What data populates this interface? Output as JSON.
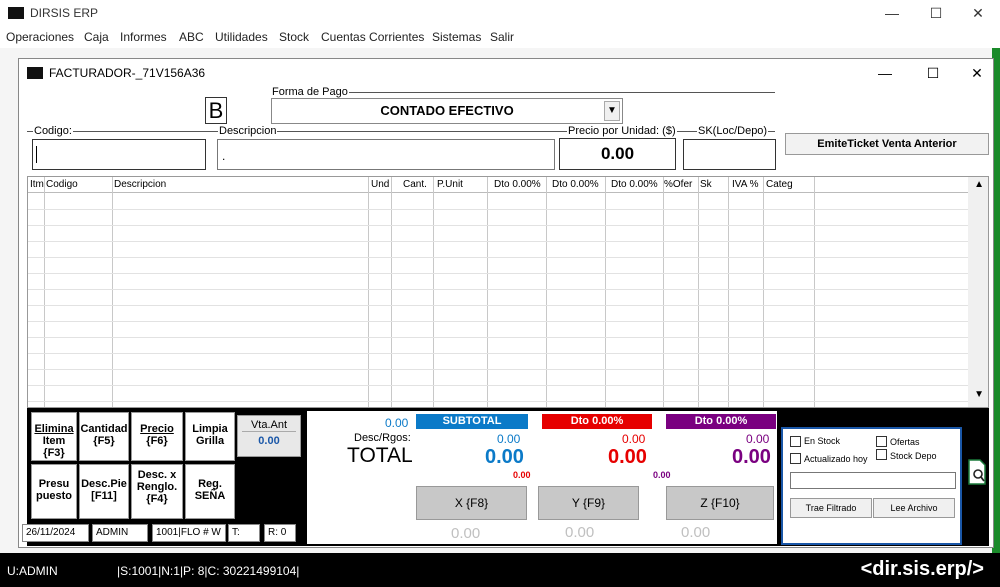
{
  "app": {
    "title": "DIRSIS ERP",
    "menu": [
      "Operaciones",
      "Caja",
      "Informes",
      "ABC",
      "Utilidades",
      "Stock",
      "Cuentas Corrientes",
      "Sistemas",
      "Salir"
    ],
    "win_min": "—",
    "win_max": "☐",
    "win_close": "✕"
  },
  "window": {
    "title": "FACTURADOR-_71V156A36",
    "min": "—",
    "max": "☐",
    "close": "✕"
  },
  "form": {
    "tipo": "B",
    "forma_pago_label": "Forma de Pago",
    "forma_pago_value": "CONTADO EFECTIVO",
    "codigo_label": "Codigo:",
    "codigo_value": "",
    "descripcion_label": "Descripcion",
    "descripcion_value": ".",
    "precio_label": "Precio por Unidad: ($)",
    "precio_value": "0.00",
    "sk_label": "SK(Loc/Depo)",
    "sk_value": "",
    "emite_label": "EmiteTicket Venta Anterior"
  },
  "grid": {
    "columns": [
      "Itm",
      "Codigo",
      "Descripcion",
      "Und",
      "Cant.",
      "P.Unit",
      "Dto 0.00%",
      "Dto 0.00%",
      "Dto 0.00%",
      "%Ofer",
      "Sk",
      "IVA %",
      "Categ"
    ]
  },
  "actions": {
    "elimina_1": "Elimina",
    "elimina_2": "Item {F3}",
    "cantidad_1": "Cantidad",
    "cantidad_2": "{F5}",
    "precio_1": "Precio",
    "precio_2": "{F6}",
    "limpia_1": "Limpia",
    "limpia_2": "Grilla",
    "vta_ant_label": "Vta.Ant",
    "vta_ant_value": "0.00",
    "presu_1": "Presu",
    "presu_2": "puesto",
    "descpie_1": "Desc.Pie",
    "descpie_2": "[F11]",
    "descx_1": "Desc. x",
    "descx_2": "Renglo.",
    "descx_3": "{F4}",
    "reg_1": "Reg.",
    "reg_2": "SEÑA"
  },
  "status_cells": {
    "date": "26/11/2024",
    "user": "ADMIN",
    "pos": "1001|FLO # W",
    "t": "T:",
    "r": "R: 0"
  },
  "totals": {
    "small_blue": "0.00",
    "desc_rgos_label": "Desc/Rgos:",
    "total_label": "TOTAL",
    "subtotal_header": "SUBTOTAL",
    "subtotal_small": "0.00",
    "subtotal_big": "0.00",
    "dto1_header": "Dto 0.00%",
    "dto1_small": "0.00",
    "dto1_big": "0.00",
    "dto1_tiny": "0.00",
    "dto2_header": "Dto 0.00%",
    "dto2_small": "0.00",
    "dto2_big": "0.00",
    "dto2_tiny": "0.00",
    "btn_x": "X {F8}",
    "btn_y": "Y {F9}",
    "btn_z": "Z {F10}",
    "foot_1": "0.00",
    "foot_2": "0.00",
    "foot_3": "0.00",
    "colors": {
      "blue": "#0b7ac8",
      "red": "#e60000",
      "purple": "#7a0080"
    }
  },
  "filters": {
    "en_stock": "En Stock",
    "ofertas": "Ofertas",
    "actualizado_hoy": "Actualizado hoy",
    "stock_depo": "Stock Depo",
    "filter_value": "",
    "trae_filtrado": "Trae Filtrado",
    "lee_archivo": "Lee Archivo"
  },
  "statusbar": {
    "user": "U:ADMIN",
    "info": "|S:1001|N:1|P:  8|C:   30221499104|",
    "brand": "<dir.sis.erp/>"
  }
}
